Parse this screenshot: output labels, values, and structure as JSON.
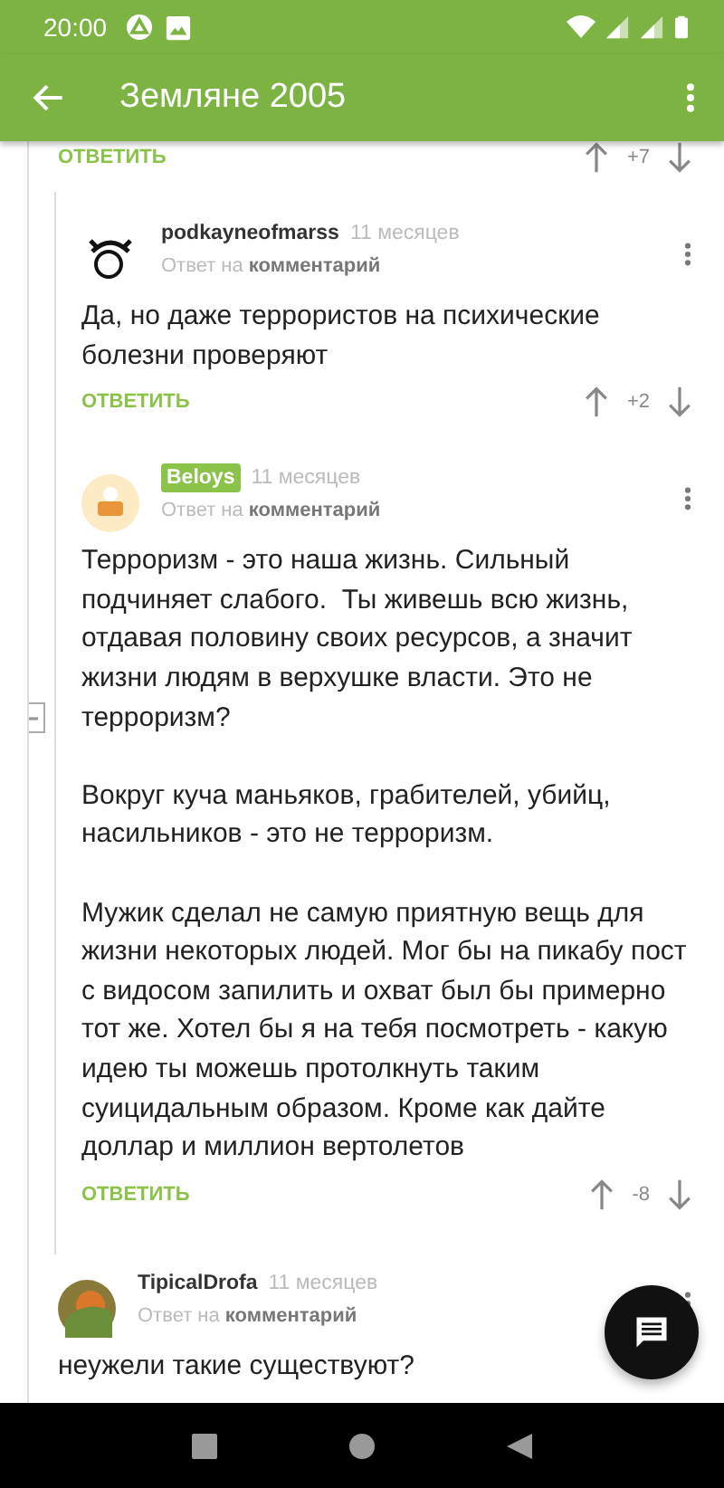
{
  "status_bar": {
    "time": "20:00"
  },
  "toolbar": {
    "title": "Земляне 2005"
  },
  "comments": [
    {
      "reply_label": "ОТВЕТИТЬ",
      "score": "+7",
      "children_expanded": true,
      "children": [
        {
          "author": "podkayneofmarss",
          "author_badge": false,
          "time": "11 месяцев",
          "reply_to_prefix": "Ответ на",
          "reply_to_link": "комментарий",
          "text": "Да, но даже террористов на психические болезни проверяют",
          "reply_label": "ОТВЕТИТЬ",
          "score": "+2"
        },
        {
          "author": "Beloys",
          "author_badge": true,
          "time": "11 месяцев",
          "reply_to_prefix": "Ответ на",
          "reply_to_link": "комментарий",
          "text": "Терроризм - это наша жизнь. Сильный подчиняет слабого.  Ты живешь всю жизнь, отдавая половину своих ресурсов, а значит жизни людям в верхушке власти. Это не терроризм?\n\nВокруг куча маньяков, грабителей, убийц, насильников - это не терроризм.\n\nМужик сделал не самую приятную вещь для жизни некоторых людей. Мог бы на пикабу пост с видосом запилить и охват был бы примерно тот же. Хотел бы я на тебя посмотреть - какую идею ты можешь протолкнуть таким суицидальным образом. Кроме как дайте доллар и миллион вертолетов",
          "reply_label": "ОТВЕТИТЬ",
          "score": "-8"
        }
      ]
    },
    {
      "author": "TipicalDrofa",
      "author_badge": false,
      "time": "11 месяцев",
      "reply_to_prefix": "Ответ на",
      "reply_to_link": "комментарий",
      "text": "неужели такие существуют?"
    }
  ]
}
